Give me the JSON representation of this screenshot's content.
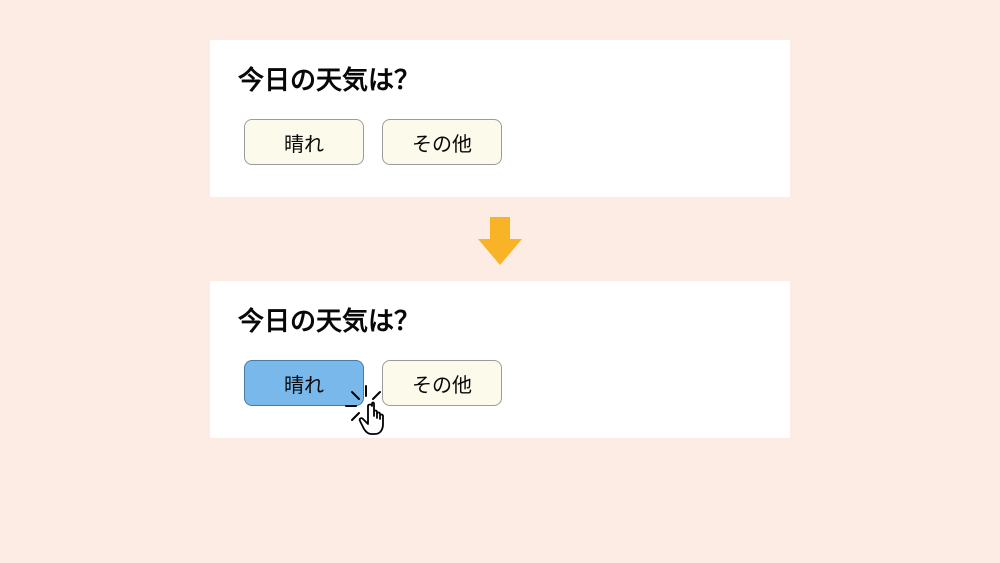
{
  "panelTop": {
    "question": "今日の天気は？",
    "options": [
      {
        "label": "晴れ",
        "selected": false
      },
      {
        "label": "その他",
        "selected": false
      }
    ]
  },
  "panelBottom": {
    "question": "今日の天気は？",
    "options": [
      {
        "label": "晴れ",
        "selected": true
      },
      {
        "label": "その他",
        "selected": false
      }
    ]
  },
  "colors": {
    "background": "#fcece3",
    "card": "#ffffff",
    "optionDefault": "#fcfbeb",
    "optionSelected": "#79b8eb",
    "arrow": "#f8b326"
  }
}
